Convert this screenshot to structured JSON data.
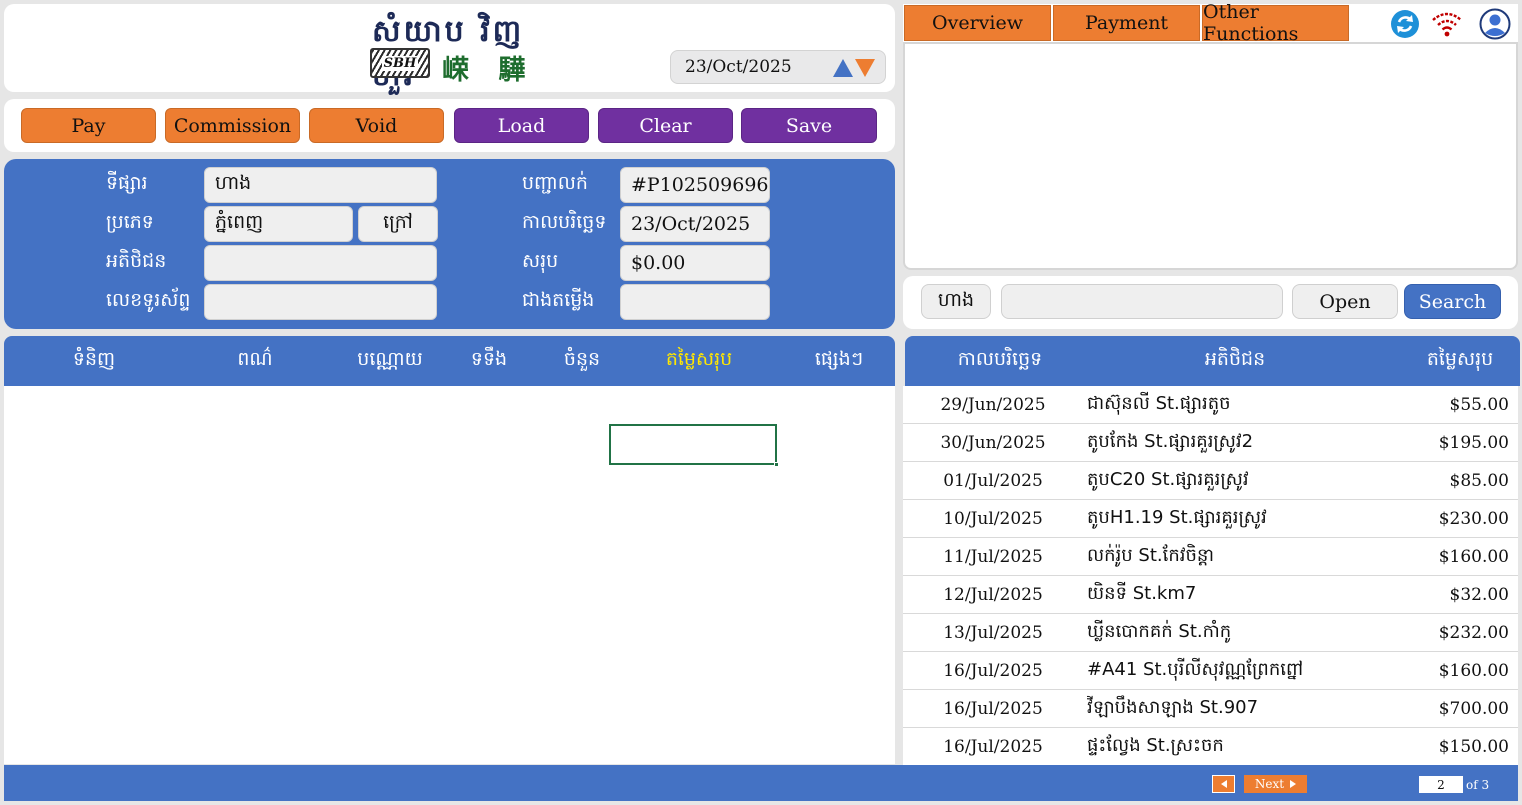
{
  "logo": {
    "khmer": "សំយាប វិញ ហួរ",
    "chinese": "嵘 驊",
    "mark_text": "SBH"
  },
  "header_date": "23/Oct/2025",
  "toolbar": {
    "pay": "Pay",
    "commission": "Commission",
    "void": "Void",
    "load": "Load",
    "clear": "Clear",
    "save": "Save"
  },
  "form": {
    "market_label": "ទីផ្សារ",
    "market_value": "ហាង",
    "type_label": "ប្រភេទ",
    "type_value": "ភ្នំពេញ",
    "type_value2": "ក្រៅ",
    "customer_label": "អតិថិជន",
    "customer_value": "",
    "phone_label": "លេខទូរស័ព្ទ",
    "phone_value": "",
    "invoice_label": "បញ្ជាលក់",
    "invoice_value": "#P102509696",
    "date_label": "កាលបរិច្ឆេទ",
    "date_value": "23/Oct/2025",
    "total_label": "សរុប",
    "total_value": "$0.00",
    "repair_label": "ជាងតម្លើង",
    "repair_value": ""
  },
  "items_header": {
    "product": "ទំនិញ",
    "color": "ពណ៌",
    "weight": "បណ្ណោយ",
    "width": "ទទឹង",
    "qty": "ចំនួន",
    "total": "តម្លៃសរុប",
    "other": "ផ្សេងៗ"
  },
  "tabs": {
    "overview": "Overview",
    "payment": "Payment",
    "other": "Other Functions"
  },
  "icons": {
    "refresh": "refresh-icon",
    "wifi": "wifi-icon",
    "user": "user-icon"
  },
  "search": {
    "filter": "ហាង",
    "query": "",
    "open": "Open",
    "search": "Search"
  },
  "history": {
    "headers": {
      "date": "កាលបរិច្ឆេទ",
      "customer": "អតិថិជន",
      "total": "តម្លៃសរុប"
    },
    "rows": [
      {
        "date": "29/Jun/2025",
        "customer": "ជាស៊ុនលី St.ផ្សារតូច",
        "total": "$55.00"
      },
      {
        "date": "30/Jun/2025",
        "customer": "តូបកែង St.ផ្សារគួរស្រូវ2",
        "total": "$195.00"
      },
      {
        "date": "01/Jul/2025",
        "customer": "តូបC20 St.ផ្សារគួរស្រូវ",
        "total": "$85.00"
      },
      {
        "date": "10/Jul/2025",
        "customer": "តូបH1.19 St.ផ្សារគួរស្រូវ",
        "total": "$230.00"
      },
      {
        "date": "11/Jul/2025",
        "customer": "លក់រ៉ូប St.កែវចិន្តា",
        "total": "$160.00"
      },
      {
        "date": "12/Jul/2025",
        "customer": "យិនទី St.km7",
        "total": "$32.00"
      },
      {
        "date": "13/Jul/2025",
        "customer": "ឃ្លីនបោកគក់ St.កាំកូ",
        "total": "$232.00"
      },
      {
        "date": "16/Jul/2025",
        "customer": "#A41 St.បុរីលីសុវណ្ណព្រែកព្នៅ",
        "total": "$160.00"
      },
      {
        "date": "16/Jul/2025",
        "customer": "វីឡាបឹងសាឡាង St.907",
        "total": "$700.00"
      },
      {
        "date": "16/Jul/2025",
        "customer": "ផ្ទះល្វែង St.ស្រះចក",
        "total": "$150.00"
      }
    ]
  },
  "pagination": {
    "next": "Next",
    "page": "2",
    "of": "of 3"
  },
  "colors": {
    "primary_blue": "#4472c4",
    "orange": "#ed7d31",
    "purple": "#7030a0",
    "highlight_yellow": "#ffe700"
  }
}
